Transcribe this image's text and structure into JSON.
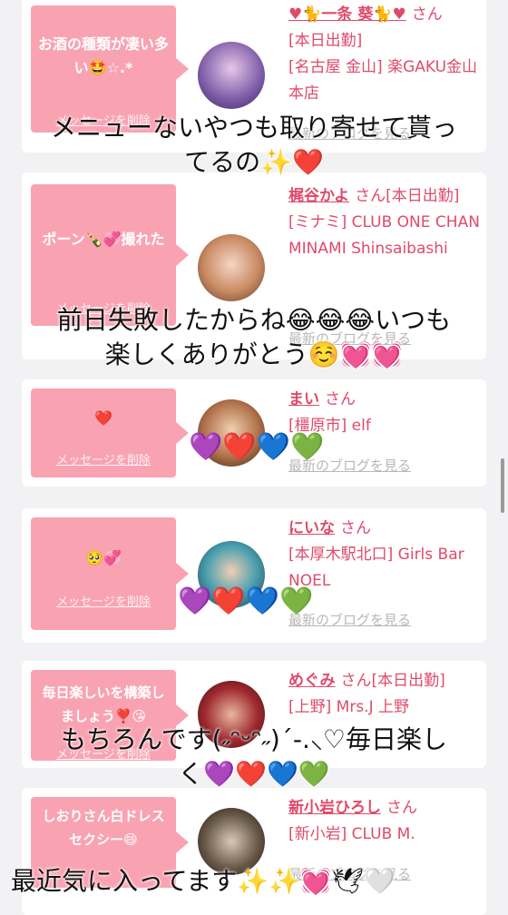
{
  "colors": {
    "accent": "#e04a6a",
    "bubble": "#f9a3b2",
    "muted": "#b8b8b8"
  },
  "san": "さん",
  "delete_label": "メッセージを削除",
  "blog_label": "最新のブログを見る",
  "entries": [
    {
      "message": "お酒の種類が凄い多い🤩☆.*",
      "name": "♥🐈一条 葵🐈♥",
      "after_name": "",
      "line2": "[本日出勤]",
      "line3": "[名古屋 金山] 楽GAKU金山本店"
    },
    {
      "message": "ポーン🍾💞撮れた",
      "name": "梶谷かよ",
      "after_name": "[本日出勤]",
      "line2": "[ミナミ] CLUB ONE CHAN MINAMI Shinsaibashi",
      "line3": ""
    },
    {
      "message": "❤️",
      "name": "まい",
      "after_name": "",
      "line2": "[橿原市] elf",
      "line3": ""
    },
    {
      "message": "🥺💞",
      "name": "にいな",
      "after_name": "",
      "line2": "[本厚木駅北口] Girls Bar NOEL",
      "line3": ""
    },
    {
      "message": "毎日楽しいを構築しましょう❣️😘",
      "name": "めぐみ",
      "after_name": "[本日出勤]",
      "line2": "[上野] Mrs.J 上野",
      "line3": ""
    },
    {
      "message": "しおりさん白ドレスセクシー😄",
      "name": "新小岩ひろし",
      "after_name": "",
      "line2": "[新小岩] CLUB M.",
      "line3": ""
    }
  ],
  "captions": {
    "c1_line1": "メニューないやつも取り寄せて貰っ",
    "c1_line2": "てるの✨❤️",
    "c2_line1": "前日失敗したからね😂😂😂いつも",
    "c2_line2": "楽しくありがとう☺️💓💓",
    "c3": "💜❤️💙💚",
    "c4": "💜❤️💙💚",
    "c5_line1": "もちろんです(˶ᵔᵕᵔ˶)´-.⸜♡毎日楽し",
    "c5_line2": "く💜❤️💙💚",
    "c6": "最近気に入ってます✨✨💓🕊🤍"
  }
}
